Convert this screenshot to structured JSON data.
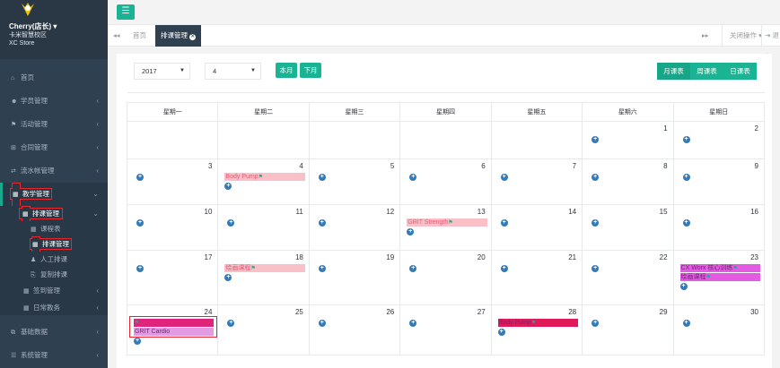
{
  "sidebar": {
    "profile": {
      "name": "Cherry(店长)",
      "school": "卡米智慧校区",
      "store": "XC Store"
    },
    "items": {
      "home": "首页",
      "students": "学员管理",
      "activities": "活动管理",
      "contracts": "合同管理",
      "ledger": "流水帐管理",
      "teaching": "教学管理",
      "scheduling": "排课管理",
      "course_table": "课程表",
      "schedule_manage": "排课管理",
      "manual_schedule": "人工排课",
      "copy_schedule": "复制排课",
      "checkin": "签到管理",
      "daily": "日常教务",
      "basic_data": "基础数据",
      "system": "系统管理"
    }
  },
  "tabs": {
    "home": "首页",
    "active": "排课管理",
    "close_ops": "关闭操作",
    "exit": "退出"
  },
  "toolbar": {
    "year": "2017",
    "month": "4",
    "this_month": "本月",
    "next_month": "下月",
    "month_view": "月课表",
    "week_view": "周课表",
    "day_view": "日课表"
  },
  "calendar": {
    "weekdays": [
      "星期一",
      "星期二",
      "星期三",
      "星期四",
      "星期五",
      "星期六",
      "星期日"
    ],
    "weeks": [
      [
        {
          "d": ""
        },
        {
          "d": ""
        },
        {
          "d": ""
        },
        {
          "d": ""
        },
        {
          "d": ""
        },
        {
          "d": "1",
          "add": true
        },
        {
          "d": "2",
          "add": true
        }
      ],
      [
        {
          "d": "3",
          "add": true
        },
        {
          "d": "4",
          "add": true,
          "events": [
            {
              "name": "Body Pump",
              "color": "#f9c0c8"
            }
          ]
        },
        {
          "d": "5",
          "add": true
        },
        {
          "d": "6",
          "add": true
        },
        {
          "d": "7",
          "add": true
        },
        {
          "d": "8",
          "add": true
        },
        {
          "d": "9",
          "add": true
        }
      ],
      [
        {
          "d": "10",
          "add": true
        },
        {
          "d": "11",
          "add": true
        },
        {
          "d": "12",
          "add": true
        },
        {
          "d": "13",
          "add": true,
          "events": [
            {
              "name": "GRIT Strength",
              "color": "#f9c0c8"
            }
          ]
        },
        {
          "d": "14",
          "add": true
        },
        {
          "d": "15",
          "add": true
        },
        {
          "d": "16",
          "add": true
        }
      ],
      [
        {
          "d": "17",
          "add": true
        },
        {
          "d": "18",
          "add": true,
          "events": [
            {
              "name": "绘画课程",
              "color": "#f9c0c8"
            }
          ]
        },
        {
          "d": "19",
          "add": true
        },
        {
          "d": "20",
          "add": true
        },
        {
          "d": "21",
          "add": true
        },
        {
          "d": "22",
          "add": true
        },
        {
          "d": "23",
          "add": true,
          "events": [
            {
              "name": "CX Worx 核心训练",
              "color": "#e35be3"
            },
            {
              "name": "绘画课程",
              "color": "#e35be3"
            }
          ]
        }
      ],
      [
        {
          "d": "24",
          "add": true,
          "hl": true,
          "events": [
            {
              "name": "",
              "color": "#e0247c"
            },
            {
              "name": "GRIT Cardio",
              "color": "#e39ae3"
            }
          ]
        },
        {
          "d": "25",
          "add": true
        },
        {
          "d": "26",
          "add": true
        },
        {
          "d": "27",
          "add": true
        },
        {
          "d": "28",
          "add": true,
          "events": [
            {
              "name": "Body Pump",
              "color": "#e0195b"
            }
          ]
        },
        {
          "d": "29",
          "add": true
        },
        {
          "d": "30",
          "add": true
        }
      ]
    ]
  }
}
